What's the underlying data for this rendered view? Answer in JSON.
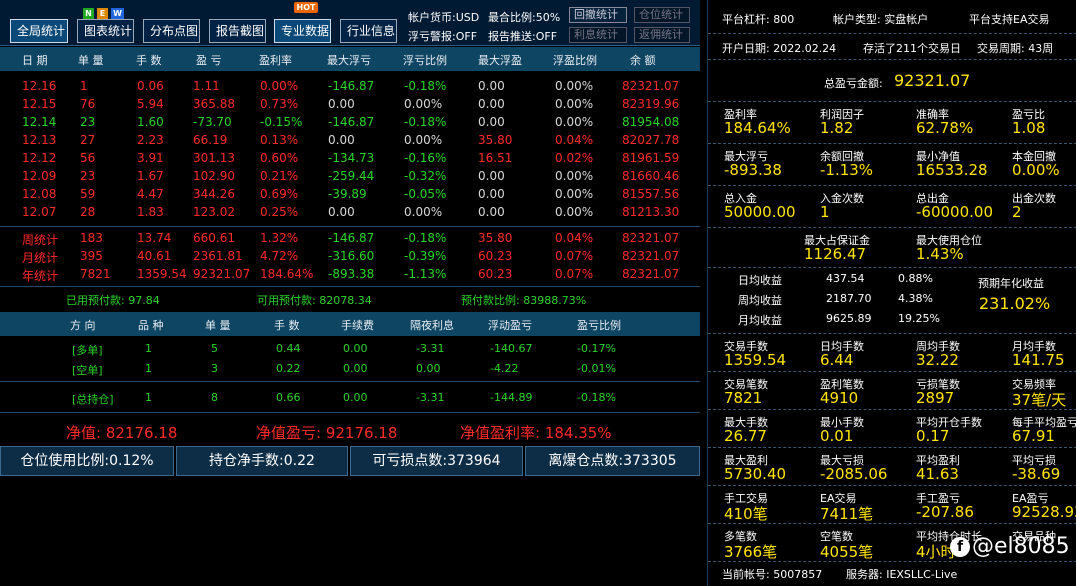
{
  "toolbar": {
    "buttons": [
      "全局统计",
      "图表统计",
      "分布点图",
      "报告截图",
      "专业数据",
      "行业信息"
    ],
    "badges": {
      "new": [
        "N",
        "E",
        "W"
      ],
      "hot": "HOT"
    },
    "info": {
      "currency": "帐户货币:USD",
      "ratio": "最合比例:50%",
      "float_alert": "浮亏警报:OFF",
      "report_push": "报告推送:OFF"
    },
    "small_buttons": [
      "回撤统计",
      "仓位统计",
      "利息统计",
      "返佣统计"
    ]
  },
  "table": {
    "headers": [
      "日 期",
      "单 量",
      "手 数",
      "盈 亏",
      "盈利率",
      "最大浮亏",
      "浮亏比例",
      "最大浮盈",
      "浮盈比例",
      "余 额"
    ],
    "rows": [
      [
        "12.16",
        "1",
        "0.06",
        "1.11",
        "0.00%",
        "-146.87",
        "-0.18%",
        "0.00",
        "0.00%",
        "82321.07"
      ],
      [
        "12.15",
        "76",
        "5.94",
        "365.88",
        "0.73%",
        "0.00",
        "0.00%",
        "0.00",
        "0.00%",
        "82319.96"
      ],
      [
        "12.14",
        "23",
        "1.60",
        "-73.70",
        "-0.15%",
        "-146.87",
        "-0.18%",
        "0.00",
        "0.00%",
        "81954.08"
      ],
      [
        "12.13",
        "27",
        "2.23",
        "66.19",
        "0.13%",
        "0.00",
        "0.00%",
        "35.80",
        "0.04%",
        "82027.78"
      ],
      [
        "12.12",
        "56",
        "3.91",
        "301.13",
        "0.60%",
        "-134.73",
        "-0.16%",
        "16.51",
        "0.02%",
        "81961.59"
      ],
      [
        "12.09",
        "23",
        "1.67",
        "102.90",
        "0.21%",
        "-259.44",
        "-0.32%",
        "0.00",
        "0.00%",
        "81660.46"
      ],
      [
        "12.08",
        "59",
        "4.47",
        "344.26",
        "0.69%",
        "-39.89",
        "-0.05%",
        "0.00",
        "0.00%",
        "81557.56"
      ],
      [
        "12.07",
        "28",
        "1.83",
        "123.02",
        "0.25%",
        "0.00",
        "0.00%",
        "0.00",
        "0.00%",
        "81213.30"
      ]
    ],
    "stats": [
      [
        "周统计",
        "183",
        "13.74",
        "660.61",
        "1.32%",
        "-146.87",
        "-0.18%",
        "35.80",
        "0.04%",
        "82321.07"
      ],
      [
        "月统计",
        "395",
        "40.61",
        "2361.81",
        "4.72%",
        "-316.60",
        "-0.39%",
        "60.23",
        "0.07%",
        "82321.07"
      ],
      [
        "年统计",
        "7821",
        "1359.54",
        "92321.07",
        "184.64%",
        "-893.38",
        "-1.13%",
        "60.23",
        "0.07%",
        "82321.07"
      ]
    ]
  },
  "prepay": {
    "used": "已用预付款: 97.84",
    "available": "可用预付款: 82078.34",
    "ratio": "预付款比例: 83988.73%"
  },
  "positions": {
    "headers": [
      "方 向",
      "品 种",
      "单 量",
      "手 数",
      "手续费",
      "隔夜利息",
      "浮动盈亏",
      "盈亏比例"
    ],
    "rows": [
      [
        "[多单]",
        "1",
        "5",
        "0.44",
        "0.00",
        "-3.31",
        "-140.67",
        "-0.17%"
      ],
      [
        "[空单]",
        "1",
        "3",
        "0.22",
        "0.00",
        "0.00",
        "-4.22",
        "-0.01%"
      ]
    ],
    "total": [
      "[总持仓]",
      "1",
      "8",
      "0.66",
      "0.00",
      "-3.31",
      "-144.89",
      "-0.18%"
    ]
  },
  "net": {
    "equity": "净值: 82176.18",
    "equity_pl": "净值盈亏: 92176.18",
    "equity_rate": "净值盈利率: 184.35%"
  },
  "bottom": [
    "仓位使用比例:0.12%",
    "持仓净手数:0.22",
    "可亏损点数:373964",
    "离爆仓点数:373305"
  ],
  "right": {
    "leverage": "平台杠杆: 800",
    "account_type": "帐户类型: 实盘帐户",
    "ea_support": "平台支持EA交易",
    "open_date": "开户日期: 2022.02.24",
    "alive": "存活了211个交易日",
    "cycle": "交易周期: 43周",
    "total_pl_label": "总盈亏金额:",
    "total_pl_value": "92321.07",
    "grid1": [
      [
        [
          "盈利率",
          "184.64%"
        ],
        [
          "利润因子",
          "1.82"
        ],
        [
          "准确率",
          "62.78%"
        ],
        [
          "盈亏比",
          "1.08"
        ]
      ],
      [
        [
          "最大浮亏",
          "-893.38"
        ],
        [
          "余额回撤",
          "-1.13%"
        ],
        [
          "最小净值",
          "16533.28"
        ],
        [
          "本金回撤",
          "0.00%"
        ]
      ],
      [
        [
          "总入金",
          "50000.00"
        ],
        [
          "入金次数",
          "1"
        ],
        [
          "总出金",
          "-60000.00"
        ],
        [
          "出金次数",
          "2"
        ]
      ]
    ],
    "margin": [
      [
        "最大占保证金",
        "1126.47"
      ],
      [
        "最大使用仓位",
        "1.43%"
      ]
    ],
    "income": {
      "rows": [
        [
          "日均收益",
          "437.54",
          "0.88%"
        ],
        [
          "周均收益",
          "2187.70",
          "4.38%"
        ],
        [
          "月均收益",
          "9625.89",
          "19.25%"
        ]
      ],
      "annual_label": "预期年化收益",
      "annual_value": "231.02%"
    },
    "grid2": [
      [
        [
          "交易手数",
          "1359.54"
        ],
        [
          "日均手数",
          "6.44"
        ],
        [
          "周均手数",
          "32.22"
        ],
        [
          "月均手数",
          "141.75"
        ]
      ],
      [
        [
          "交易笔数",
          "7821"
        ],
        [
          "盈利笔数",
          "4910"
        ],
        [
          "亏损笔数",
          "2897"
        ],
        [
          "交易频率",
          "37笔/天"
        ]
      ],
      [
        [
          "最大手数",
          "26.77"
        ],
        [
          "最小手数",
          "0.01"
        ],
        [
          "平均开仓手数",
          "0.17"
        ],
        [
          "每手平均盈亏",
          "67.91"
        ]
      ],
      [
        [
          "最大盈利",
          "5730.40"
        ],
        [
          "最大亏损",
          "-2085.06"
        ],
        [
          "平均盈利",
          "41.63"
        ],
        [
          "平均亏损",
          "-38.69"
        ]
      ],
      [
        [
          "手工交易",
          "410笔"
        ],
        [
          "EA交易",
          "7411笔"
        ],
        [
          "手工盈亏",
          "-207.86"
        ],
        [
          "EA盈亏",
          "92528.93"
        ]
      ],
      [
        [
          "多笔数",
          "3766笔"
        ],
        [
          "空笔数",
          "4055笔"
        ],
        [
          "平均持仓时长",
          "4小时"
        ],
        [
          "交易品种",
          ""
        ]
      ]
    ],
    "account": "当前帐号: 5007857",
    "server": "服务器: IEXSLLC-Live"
  },
  "watermark": "@el8085",
  "colors": {
    "up": "#ff2a2a",
    "down": "#2bd42b",
    "value": "#ffe600",
    "header": "#0e4563"
  }
}
